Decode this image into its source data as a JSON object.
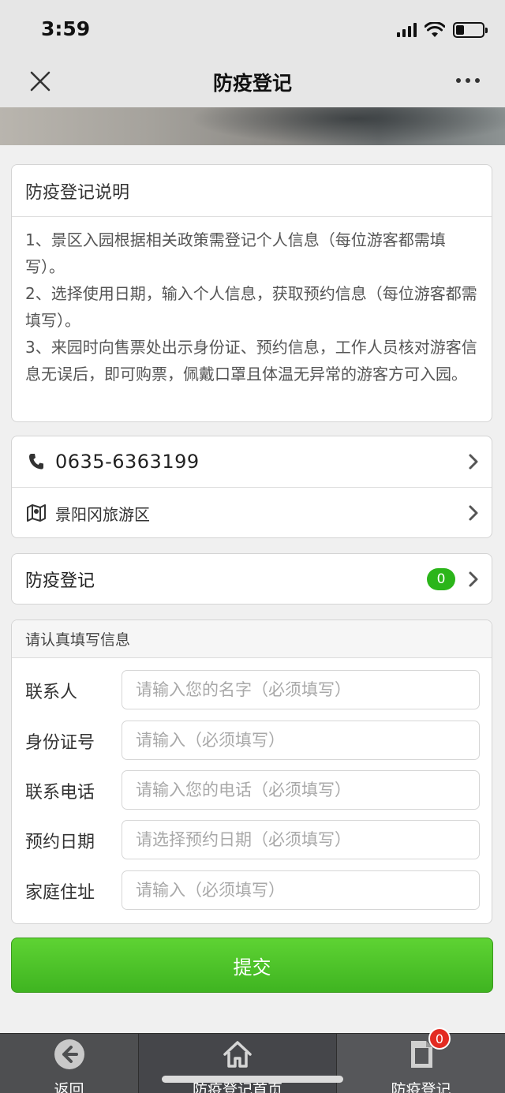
{
  "status": {
    "time": "3:59"
  },
  "nav": {
    "title": "防疫登记"
  },
  "intro": {
    "title": "防疫登记说明",
    "lines": [
      "1、景区入园根据相关政策需登记个人信息（每位游客都需填写）。",
      "2、选择使用日期，输入个人信息，获取预约信息（每位游客都需填写）。",
      "3、来园时向售票处出示身份证、预约信息，工作人员核对游客信息无误后，即可购票，佩戴口罩且体温无异常的游客方可入园。"
    ]
  },
  "contact": {
    "phone": "0635-6363199",
    "location": "景阳冈旅游区"
  },
  "register": {
    "label": "防疫登记",
    "count": "0"
  },
  "form": {
    "header": "请认真填写信息",
    "fields": [
      {
        "label": "联系人",
        "placeholder": "请输入您的名字（必须填写）"
      },
      {
        "label": "身份证号",
        "placeholder": "请输入（必须填写）"
      },
      {
        "label": "联系电话",
        "placeholder": "请输入您的电话（必须填写）"
      },
      {
        "label": "预约日期",
        "placeholder": "请选择预约日期（必须填写）"
      },
      {
        "label": "家庭住址",
        "placeholder": "请输入（必须填写）"
      }
    ],
    "submit_label": "提交"
  },
  "tabbar": {
    "back_label": "返回",
    "home_label": "防疫登记首页",
    "register_label": "防疫登记",
    "register_badge": "0"
  },
  "colors": {
    "accent_green": "#3fb421",
    "badge_red": "#e32b22",
    "tabbar_bg": "#4e4f51"
  }
}
